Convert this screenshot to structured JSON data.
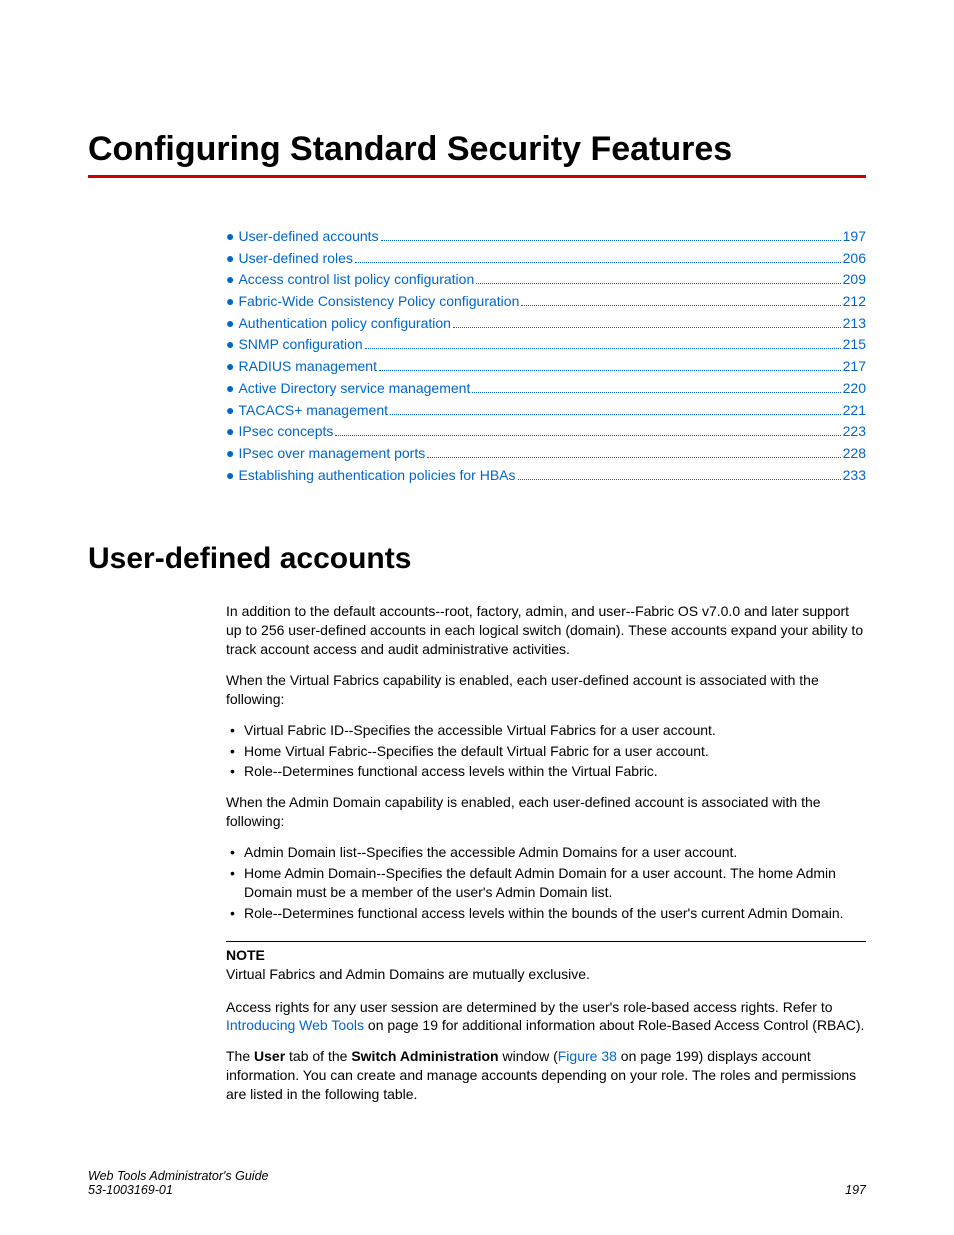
{
  "chapterTitle": "Configuring Standard Security Features",
  "toc": [
    {
      "label": "User-defined accounts",
      "page": "197"
    },
    {
      "label": "User-defined roles",
      "page": "206"
    },
    {
      "label": "Access control list policy configuration",
      "page": "209"
    },
    {
      "label": "Fabric-Wide Consistency Policy configuration",
      "page": "212"
    },
    {
      "label": "Authentication policy configuration",
      "page": "213"
    },
    {
      "label": "SNMP configuration",
      "page": "215"
    },
    {
      "label": "RADIUS management",
      "page": "217"
    },
    {
      "label": "Active Directory service management",
      "page": "220"
    },
    {
      "label": "TACACS+ management",
      "page": "221"
    },
    {
      "label": "IPsec concepts",
      "page": "223"
    },
    {
      "label": "IPsec over management ports",
      "page": "228"
    },
    {
      "label": "Establishing authentication policies for HBAs",
      "page": "233"
    }
  ],
  "sectionTitle": "User-defined accounts",
  "para1": "In addition to the default accounts--root, factory, admin, and user--Fabric OS v7.0.0 and later support up to 256 user-defined accounts in each logical switch (domain). These accounts expand your ability to track account access and audit administrative activities.",
  "para2": "When the Virtual Fabrics capability is enabled, each user-defined account is associated with the following:",
  "bulletsA": [
    "Virtual Fabric ID--Specifies the accessible Virtual Fabrics for a user account.",
    "Home Virtual Fabric--Specifies the default Virtual Fabric for a user account.",
    "Role--Determines functional access levels within the Virtual Fabric."
  ],
  "para3": "When the Admin Domain capability is enabled, each user-defined account is associated with the following:",
  "bulletsB": [
    "Admin Domain list--Specifies the accessible Admin Domains for a user account.",
    "Home Admin Domain--Specifies the default Admin Domain for a user account. The home Admin Domain must be a member of the user's Admin Domain list.",
    "Role--Determines functional access levels within the bounds of the user's current Admin Domain."
  ],
  "noteLabel": "NOTE",
  "noteText": "Virtual Fabrics and Admin Domains are mutually exclusive.",
  "para4a": "Access rights for any user session are determined by the user's role-based access rights. Refer to ",
  "para4link": "Introducing Web Tools",
  "para4b": " on page 19 for additional information about Role-Based Access Control (RBAC).",
  "para5a": "The ",
  "para5b1": "User",
  "para5c": " tab of the ",
  "para5b2": "Switch Administration",
  "para5d": " window (",
  "para5link": "Figure 38",
  "para5e": " on page 199) displays account information. You can create and manage accounts depending on your role. The roles and permissions are listed in the following table.",
  "footer": {
    "title": "Web Tools Administrator's Guide",
    "docnum": "53-1003169-01",
    "page": "197"
  }
}
